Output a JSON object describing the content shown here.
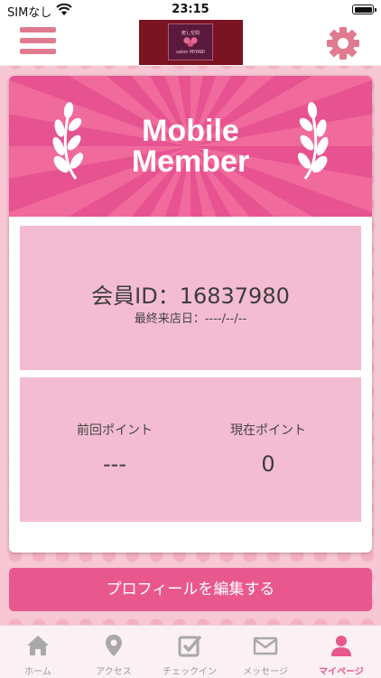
{
  "status_bar": {
    "carrier": "SIMなし",
    "time": "23:15"
  },
  "header": {
    "logo_line1": "癒し空間",
    "logo_line2": "salon MIYABI"
  },
  "banner": {
    "title_line1": "Mobile",
    "title_line2": "Member"
  },
  "member": {
    "id_text": "会員ID：16837980",
    "last_visit_text": "最終来店日：----/--/--"
  },
  "points": {
    "previous_label": "前回ポイント",
    "previous_value": "---",
    "current_label": "現在ポイント",
    "current_value": "0"
  },
  "edit_profile_label": "プロフィールを編集する",
  "tabs": [
    {
      "label": "ホーム",
      "icon": "home-icon",
      "active": false
    },
    {
      "label": "アクセス",
      "icon": "map-pin-icon",
      "active": false
    },
    {
      "label": "チェックイン",
      "icon": "checkin-icon",
      "active": false
    },
    {
      "label": "メッセージ",
      "icon": "mail-icon",
      "active": false
    },
    {
      "label": "マイページ",
      "icon": "user-icon",
      "active": true
    }
  ],
  "colors": {
    "accent": "#e9578f",
    "menu": "#e07b8f",
    "panel": "#f4bcd2",
    "logo_bg": "#7a1422"
  }
}
